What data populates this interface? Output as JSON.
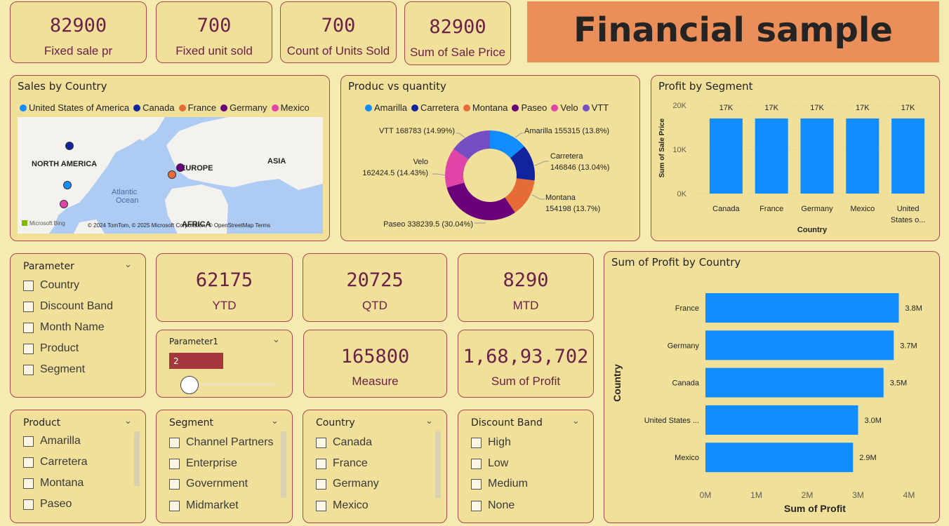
{
  "header": {
    "title": "Financial sample"
  },
  "kpis_top": [
    {
      "value": "82900",
      "label": "Fixed sale pr"
    },
    {
      "value": "700",
      "label": "Fixed unit sold"
    },
    {
      "value": "700",
      "label": "Count of Units Sold"
    },
    {
      "value": "82900",
      "label": "Sum of Sale Price"
    }
  ],
  "kpis_mid": [
    {
      "value": "62175",
      "label": "YTD"
    },
    {
      "value": "20725",
      "label": "QTD"
    },
    {
      "value": "8290",
      "label": "MTD"
    },
    {
      "value": "165800",
      "label": "Measure"
    },
    {
      "value": "1,68,93,702",
      "label": "Sum of Profit"
    }
  ],
  "map": {
    "title": "Sales by Country",
    "legend": [
      {
        "name": "United States of America",
        "color": "#118dff"
      },
      {
        "name": "Canada",
        "color": "#12239e"
      },
      {
        "name": "France",
        "color": "#e66c37"
      },
      {
        "name": "Germany",
        "color": "#6b007b"
      },
      {
        "name": "Mexico",
        "color": "#e044a7"
      }
    ],
    "labels": [
      "NORTH AMERICA",
      "EUROPE",
      "ASIA",
      "Atlantic",
      "Ocean",
      "AFRICA"
    ],
    "attribution": "© 2024 TomTom, © 2025 Microsoft Corporation, © OpenStreetMap  Terms",
    "bing": "Microsoft Bing"
  },
  "donut": {
    "title": "Produc vs quantity",
    "legend": [
      {
        "name": "Amarilla",
        "color": "#118dff"
      },
      {
        "name": "Carretera",
        "color": "#12239e"
      },
      {
        "name": "Montana",
        "color": "#e66c37"
      },
      {
        "name": "Paseo",
        "color": "#6b007b"
      },
      {
        "name": "Velo",
        "color": "#e044a7"
      },
      {
        "name": "VTT",
        "color": "#744ec2"
      }
    ],
    "labels": {
      "amarilla": "Amarilla 155315 (13.8%)",
      "carretera_1": "Carretera",
      "carretera_2": "146846 (13.04%)",
      "montana_1": "Montana",
      "montana_2": "154198 (13.7%)",
      "paseo": "Paseo 338239.5 (30.04%)",
      "velo_1": "Velo",
      "velo_2": "162424.5 (14.43%)",
      "vtt": "VTT 168783 (14.99%)"
    }
  },
  "parameter_slicer": {
    "title": "Parameter",
    "items": [
      "Country",
      "Discount Band",
      "Month Name",
      "Product",
      "Segment"
    ]
  },
  "parameter1": {
    "title": "Parameter1",
    "value": "2"
  },
  "slicers": [
    {
      "title": "Product",
      "items": [
        "Amarilla",
        "Carretera",
        "Montana",
        "Paseo"
      ]
    },
    {
      "title": "Segment",
      "items": [
        "Channel Partners",
        "Enterprise",
        "Government",
        "Midmarket"
      ]
    },
    {
      "title": "Country",
      "items": [
        "Canada",
        "France",
        "Germany",
        "Mexico"
      ]
    },
    {
      "title": "Discount Band",
      "items": [
        "High",
        "Low",
        "Medium",
        "None"
      ]
    }
  ],
  "chart_data": [
    {
      "type": "pie",
      "title": "Produc vs quantity",
      "categories": [
        "Amarilla",
        "Carretera",
        "Montana",
        "Paseo",
        "Velo",
        "VTT"
      ],
      "values": [
        155315,
        146846,
        154198,
        338239.5,
        162424.5,
        168783
      ],
      "percent_labels": [
        "13.8%",
        "13.04%",
        "13.7%",
        "30.04%",
        "14.43%",
        "14.99%"
      ],
      "colors": [
        "#118dff",
        "#12239e",
        "#e66c37",
        "#6b007b",
        "#e044a7",
        "#744ec2"
      ],
      "legend_position": "top"
    },
    {
      "type": "bar",
      "title": "Profit by Segment",
      "categories": [
        "Canada",
        "France",
        "Germany",
        "Mexico",
        "United States o..."
      ],
      "values": [
        17000,
        17000,
        17000,
        17000,
        17000
      ],
      "data_labels": [
        "17K",
        "17K",
        "17K",
        "17K",
        "17K"
      ],
      "xlabel": "Country",
      "ylabel": "Sum of Sale Price",
      "ylim": [
        0,
        20000
      ],
      "yticks": [
        "0K",
        "10K",
        "20K"
      ],
      "color": "#118dff"
    },
    {
      "type": "bar",
      "orientation": "horizontal",
      "title": "Sum of Profit by Country",
      "categories": [
        "France",
        "Germany",
        "Canada",
        "United States ...",
        "Mexico"
      ],
      "values": [
        3.8,
        3.7,
        3.5,
        3.0,
        2.9
      ],
      "data_labels": [
        "3.8M",
        "3.7M",
        "3.5M",
        "3.0M",
        "2.9M"
      ],
      "xlabel": "Sum of Profit",
      "ylabel": "Country",
      "xlim": [
        0,
        4
      ],
      "xticks": [
        "0M",
        "1M",
        "2M",
        "3M",
        "4M"
      ],
      "color": "#118dff"
    }
  ]
}
